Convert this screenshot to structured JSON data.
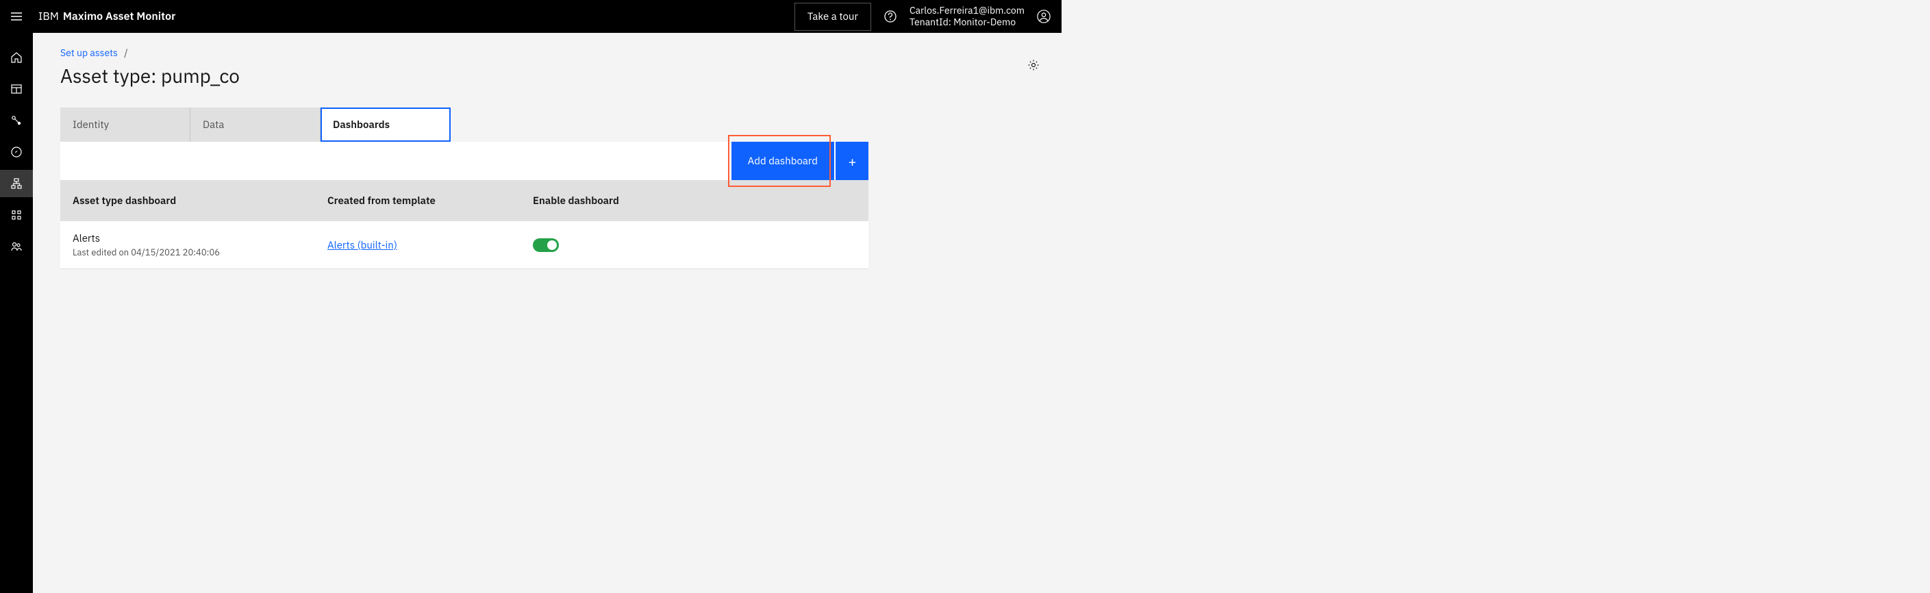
{
  "header": {
    "brand_prefix": "IBM",
    "brand_product": "Maximo Asset Monitor",
    "tour_label": "Take a tour",
    "user_email": "Carlos.Ferreira1@ibm.com",
    "tenant_label": "TenantId: Monitor-Demo"
  },
  "breadcrumb": {
    "parent": "Set up assets",
    "separator": "/"
  },
  "page": {
    "title": "Asset type: pump_co"
  },
  "tabs": [
    {
      "label": "Identity",
      "active": false
    },
    {
      "label": "Data",
      "active": false
    },
    {
      "label": "Dashboards",
      "active": true
    }
  ],
  "actions": {
    "add_dashboard": "Add dashboard",
    "plus": "+"
  },
  "table": {
    "columns": {
      "name": "Asset type dashboard",
      "template": "Created from template",
      "enable": "Enable dashboard"
    },
    "rows": [
      {
        "name": "Alerts",
        "meta": "Last edited on 04/15/2021 20:40:06",
        "template": "Alerts (built-in)",
        "enabled": true
      }
    ]
  }
}
